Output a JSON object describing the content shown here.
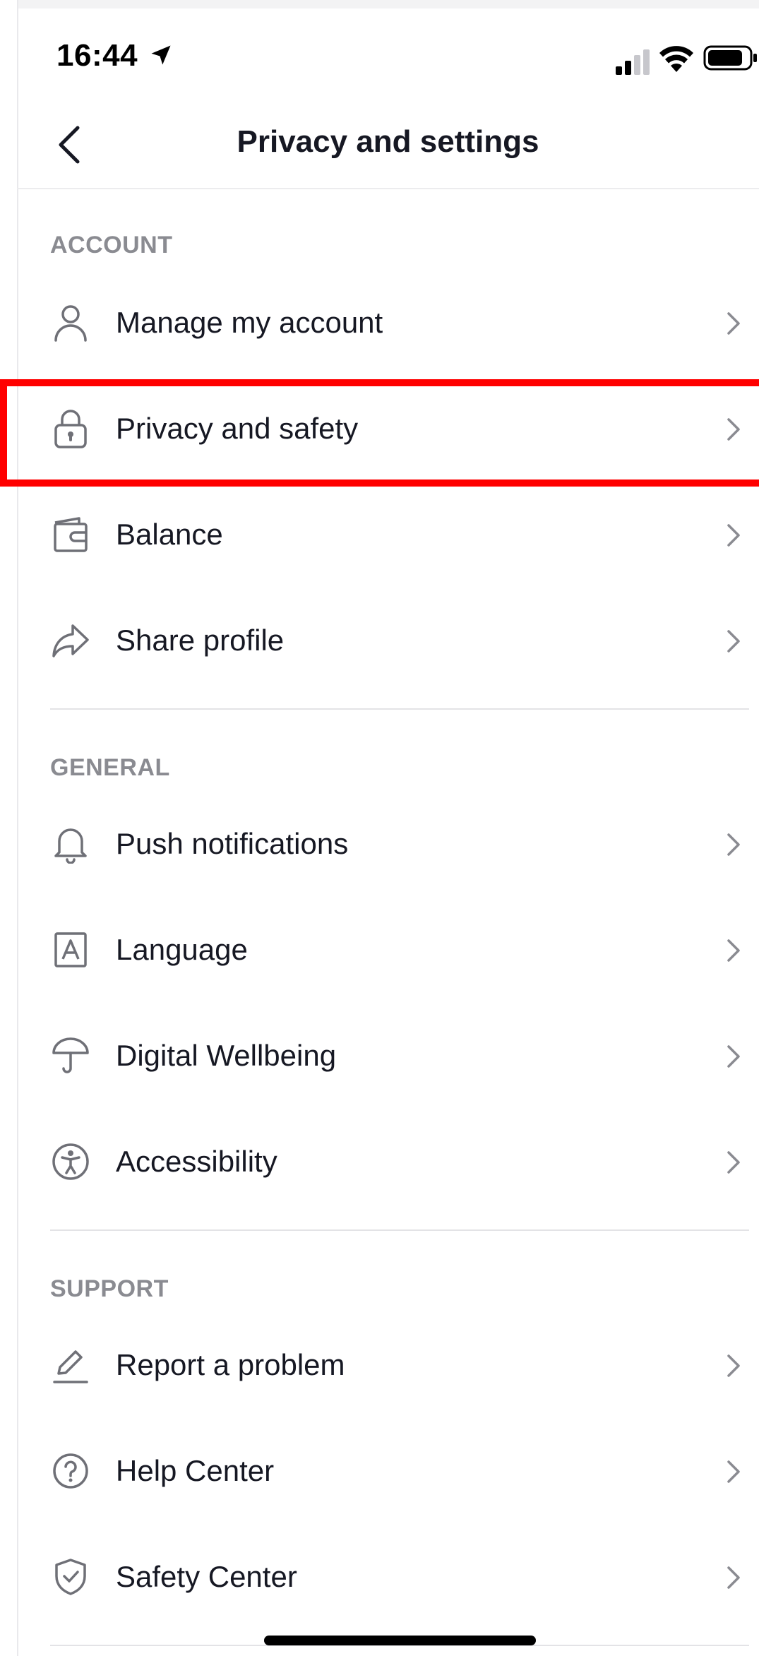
{
  "status_bar": {
    "time": "16:44"
  },
  "nav": {
    "title": "Privacy and settings"
  },
  "sections": [
    {
      "header": "ACCOUNT",
      "items": [
        {
          "label": "Manage my account",
          "icon": "person-icon"
        },
        {
          "label": "Privacy and safety",
          "icon": "lock-icon"
        },
        {
          "label": "Balance",
          "icon": "wallet-icon"
        },
        {
          "label": "Share profile",
          "icon": "share-icon"
        }
      ]
    },
    {
      "header": "GENERAL",
      "items": [
        {
          "label": "Push notifications",
          "icon": "bell-icon"
        },
        {
          "label": "Language",
          "icon": "language-icon"
        },
        {
          "label": "Digital Wellbeing",
          "icon": "umbrella-icon"
        },
        {
          "label": "Accessibility",
          "icon": "accessibility-icon"
        }
      ]
    },
    {
      "header": "SUPPORT",
      "items": [
        {
          "label": "Report a problem",
          "icon": "pencil-icon"
        },
        {
          "label": "Help Center",
          "icon": "help-icon"
        },
        {
          "label": "Safety Center",
          "icon": "shield-icon"
        }
      ]
    }
  ],
  "colors": {
    "highlight": "#ff0000",
    "text": "#161823",
    "section_header": "#8a8b91",
    "icon": "#6f7077"
  }
}
